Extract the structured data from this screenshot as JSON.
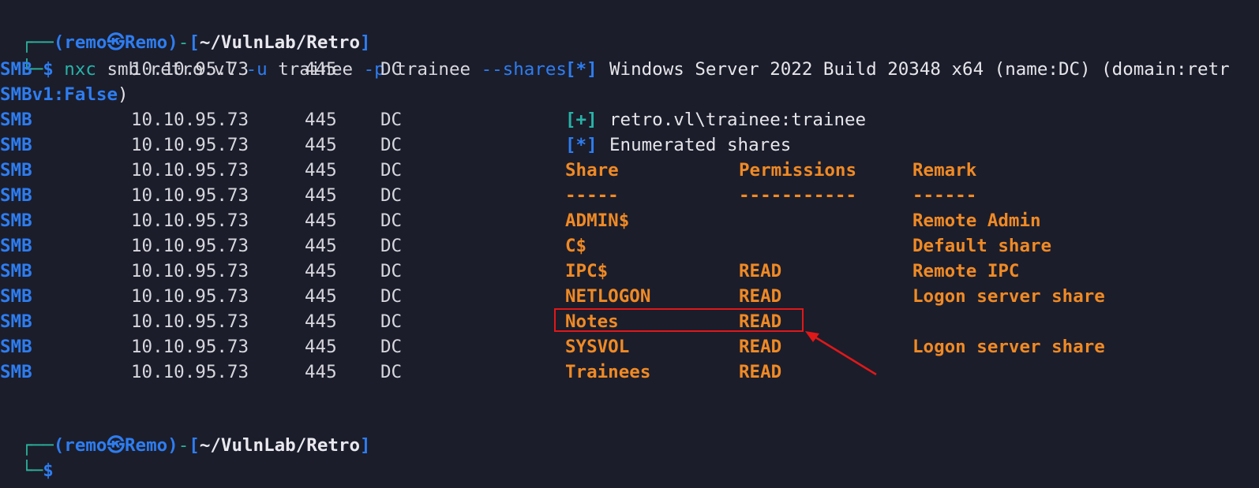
{
  "prompt": {
    "user": "remo",
    "skull": "㉿",
    "host": "Remo",
    "path": "~/VulnLab/Retro",
    "frame_top": "┌──",
    "frame_bottom": "└─",
    "dollar": "$"
  },
  "command": {
    "binary": "nxc",
    "protocol": "smb",
    "target": "retro.vl",
    "user_flag": "-u",
    "user_value": "trainee",
    "pass_flag": "-p",
    "pass_value": "trainee",
    "option": "--shares"
  },
  "output": {
    "proto": "SMB",
    "ip": "10.10.95.73",
    "port": "445",
    "host": "DC",
    "banner": "Windows Server 2022 Build 20348 x64 (name:DC) (domain:retr",
    "banner_wrap": "SMBv1:False",
    "banner_wrap_end": ")",
    "auth": "retro.vl\\trainee:trainee",
    "enum": "Enumerated shares",
    "star_tag": "[*]",
    "plus_tag": "[+]",
    "headers": [
      "Share",
      "Permissions",
      "Remark"
    ],
    "separators": [
      "-----",
      "-----------",
      "------"
    ],
    "shares": [
      {
        "name": "ADMIN$",
        "perm": "",
        "remark": "Remote Admin"
      },
      {
        "name": "C$",
        "perm": "",
        "remark": "Default share"
      },
      {
        "name": "IPC$",
        "perm": "READ",
        "remark": "Remote IPC"
      },
      {
        "name": "NETLOGON",
        "perm": "READ",
        "remark": "Logon server share"
      },
      {
        "name": "Notes",
        "perm": "READ",
        "remark": ""
      },
      {
        "name": "SYSVOL",
        "perm": "READ",
        "remark": "Logon server share"
      },
      {
        "name": "Trainees",
        "perm": "READ",
        "remark": ""
      }
    ]
  },
  "annotation": {
    "highlight_color": "#e01818",
    "highlighted_share": "Notes"
  },
  "colors": {
    "background": "#1b1d2b",
    "blue": "#2e7df0",
    "teal": "#27b3a8",
    "orange": "#f08a24",
    "text": "#d7d7dd"
  }
}
